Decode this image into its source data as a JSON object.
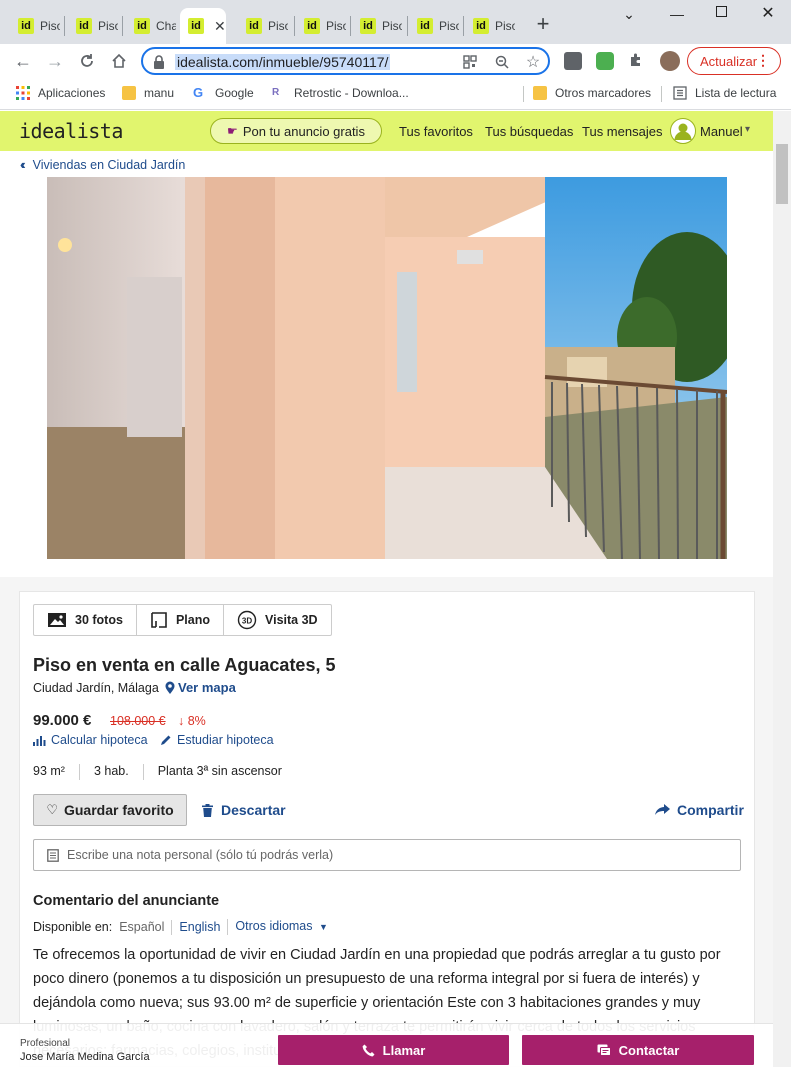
{
  "browser": {
    "tabs": [
      {
        "label": "Piso",
        "favicon": "id"
      },
      {
        "label": "Piso",
        "favicon": "id"
      },
      {
        "label": "Cha",
        "favicon": "id"
      },
      {
        "label": "",
        "favicon": "id",
        "active": true
      },
      {
        "label": "Piso",
        "favicon": "id"
      },
      {
        "label": "Piso",
        "favicon": "id"
      },
      {
        "label": "Piso",
        "favicon": "id"
      },
      {
        "label": "Piso",
        "favicon": "id"
      },
      {
        "label": "Piso",
        "favicon": "id"
      }
    ],
    "url": "idealista.com/inmueble/95740117/",
    "update_button": "Actualizar",
    "bookmarks": [
      "Aplicaciones",
      "manu",
      "Google",
      "Retrostic - Downloa...",
      "Otros marcadores",
      "Lista de lectura"
    ]
  },
  "site": {
    "logo": "idealista",
    "ad_button": "Pon tu anuncio gratis",
    "nav": [
      "Tus favoritos",
      "Tus búsquedas",
      "Tus mensajes"
    ],
    "user": "Manuel"
  },
  "breadcrumb": "Viviendas en Ciudad Jardín",
  "media_tabs": [
    "30 fotos",
    "Plano",
    "Visita 3D"
  ],
  "listing": {
    "title": "Piso en venta en calle Aguacates, 5",
    "location": "Ciudad Jardín, Málaga",
    "map_link": "Ver mapa",
    "price": "99.000 €",
    "old_price": "108.000 €",
    "price_drop": "↓ 8%",
    "calc_mortgage": "Calcular hipoteca",
    "study_mortgage": "Estudiar hipoteca",
    "features": [
      "93 m²",
      "3 hab.",
      "Planta 3ª sin ascensor"
    ]
  },
  "actions": {
    "favorite": "Guardar favorito",
    "discard": "Descartar",
    "share": "Compartir",
    "note_placeholder": "Escribe una nota personal (sólo tú podrás verla)"
  },
  "comment": {
    "title": "Comentario del anunciante",
    "available_label": "Disponible en:",
    "languages": [
      "Español",
      "English",
      "Otros idiomas"
    ],
    "text": "Te ofrecemos la oportunidad de vivir en Ciudad Jardín en una propiedad que podrás arreglar a tu gusto por poco dinero (ponemos a tu disposición un presupuesto de una reforma integral por si fuera de interés) y dejándola como nueva; sus 93.00 m² de superficie y orientación Este con 3 habitaciones grandes y muy luminosas, un baño, cocina con lavadero, salón y terraza te permitirán vivir cerca de todos los servicios necesarios: farmacias, colegios, institutos..."
  },
  "contact": {
    "type": "Profesional",
    "name": "Jose María Medina García",
    "call": "Llamar",
    "contact": "Contactar"
  },
  "colors": {
    "brand_yellow": "#e1f56e",
    "brand_purple": "#a6206b",
    "link_blue": "#1f4c8c",
    "price_red": "#d93025"
  }
}
